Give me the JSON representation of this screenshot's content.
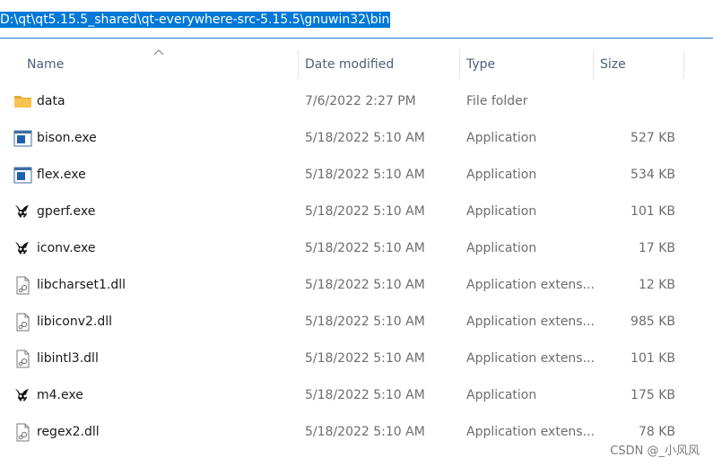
{
  "address": "D:\\qt\\qt5.15.5_shared\\qt-everywhere-src-5.15.5\\gnuwin32\\bin",
  "columns": {
    "name": "Name",
    "date": "Date modified",
    "type": "Type",
    "size": "Size"
  },
  "files": [
    {
      "name": "data",
      "date": "7/6/2022 2:27 PM",
      "type": "File folder",
      "size": "",
      "icon": "folder-icon"
    },
    {
      "name": "bison.exe",
      "date": "5/18/2022 5:10 AM",
      "type": "Application",
      "size": "527 KB",
      "icon": "application-window-icon"
    },
    {
      "name": "flex.exe",
      "date": "5/18/2022 5:10 AM",
      "type": "Application",
      "size": "534 KB",
      "icon": "application-window-icon"
    },
    {
      "name": "gperf.exe",
      "date": "5/18/2022 5:10 AM",
      "type": "Application",
      "size": "101 KB",
      "icon": "gnu-icon"
    },
    {
      "name": "iconv.exe",
      "date": "5/18/2022 5:10 AM",
      "type": "Application",
      "size": "17 KB",
      "icon": "gnu-icon"
    },
    {
      "name": "libcharset1.dll",
      "date": "5/18/2022 5:10 AM",
      "type": "Application extens...",
      "size": "12 KB",
      "icon": "dll-file-icon"
    },
    {
      "name": "libiconv2.dll",
      "date": "5/18/2022 5:10 AM",
      "type": "Application extens...",
      "size": "985 KB",
      "icon": "dll-file-icon"
    },
    {
      "name": "libintl3.dll",
      "date": "5/18/2022 5:10 AM",
      "type": "Application extens...",
      "size": "101 KB",
      "icon": "dll-file-icon"
    },
    {
      "name": "m4.exe",
      "date": "5/18/2022 5:10 AM",
      "type": "Application",
      "size": "175 KB",
      "icon": "gnu-icon"
    },
    {
      "name": "regex2.dll",
      "date": "5/18/2022 5:10 AM",
      "type": "Application extens...",
      "size": "78 KB",
      "icon": "dll-file-icon"
    }
  ],
  "watermark": "CSDN @_小风风",
  "colors": {
    "selection": "#0078d7",
    "header_text": "#4c607a",
    "secondary_text": "#6d6d6d",
    "folder": "#f8c44f"
  }
}
